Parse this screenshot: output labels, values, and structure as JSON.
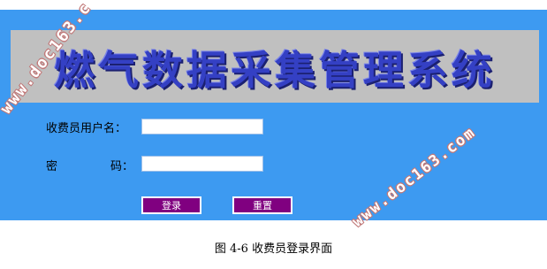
{
  "app": {
    "title": "燃气数据采集管理系统"
  },
  "form": {
    "username_label": "收费员用户名：",
    "password_label_left": "密",
    "password_label_right": "码：",
    "username_value": "",
    "password_value": ""
  },
  "buttons": {
    "login": "登录",
    "reset": "重置"
  },
  "caption": "图 4-6  收费员登录界面",
  "watermarks": [
    "www.doc163.c",
    "www.doc163.com"
  ],
  "colors": {
    "panel_bg": "#3d9af1",
    "banner_bg": "#c0c0c0",
    "title_color": "#3440c4",
    "button_bg": "#800080"
  }
}
